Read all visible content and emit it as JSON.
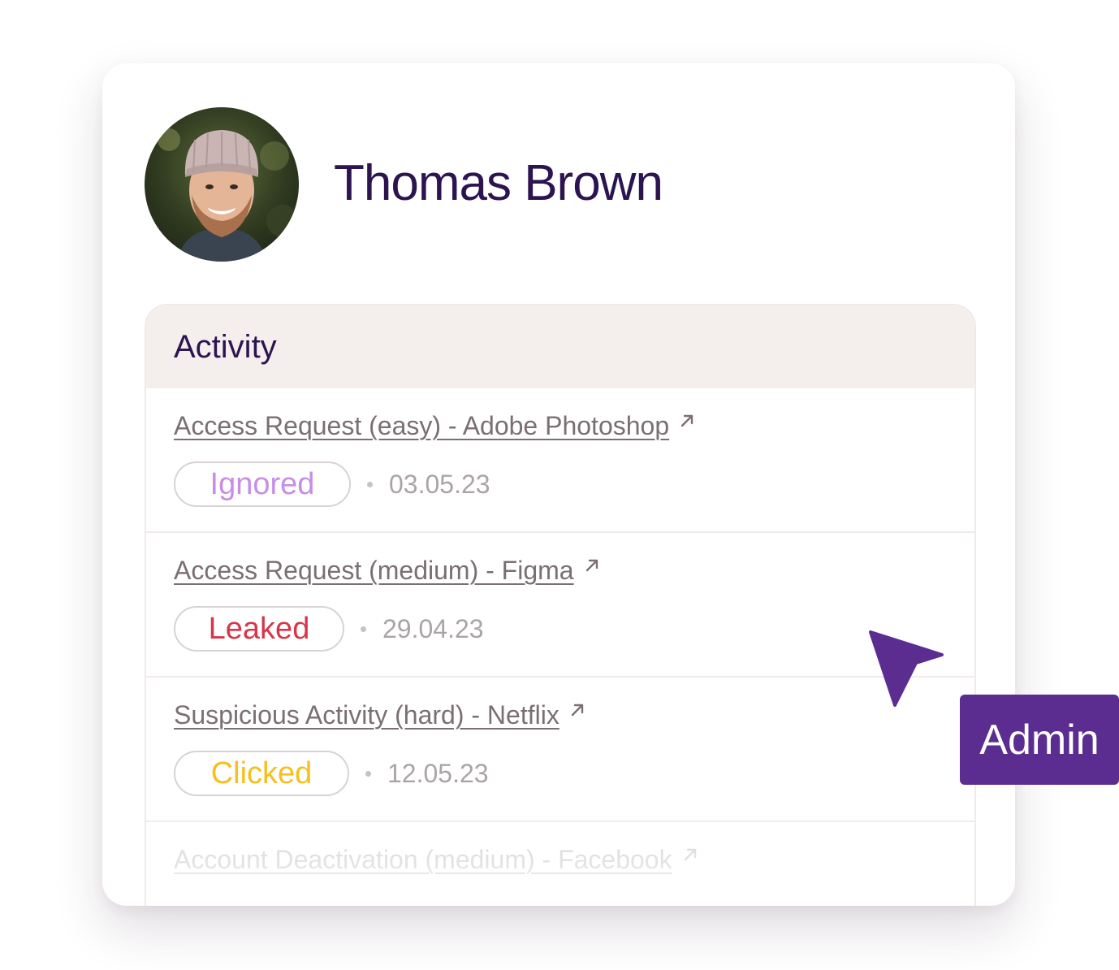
{
  "profile": {
    "name": "Thomas Brown"
  },
  "activity": {
    "title": "Activity",
    "items": [
      {
        "link": "Access Request (easy) - Adobe Photoshop",
        "link_icon": "external-link-icon",
        "status": "Ignored",
        "status_color": "#c88de6",
        "date": "03.05.23"
      },
      {
        "link": "Access Request (medium) - Figma",
        "link_icon": "external-link-icon",
        "status": "Leaked",
        "status_color": "#d6364a",
        "date": "29.04.23"
      },
      {
        "link": "Suspicious Activity (hard) - Netflix",
        "link_icon": "external-link-icon",
        "status": "Clicked",
        "status_color": "#f5c01c",
        "date": "12.05.23"
      },
      {
        "link": "Account Deactivation (medium) - Facebook",
        "link_icon": "external-link-icon"
      }
    ]
  },
  "cursor": {
    "label": "Admin",
    "color": "#5c2d91",
    "icon": "cursor-pointer-icon"
  },
  "colors": {
    "heading": "#2c1450",
    "link": "#7a6f72",
    "date": "#aba4a5",
    "panel_header_bg": "#f4efed"
  }
}
